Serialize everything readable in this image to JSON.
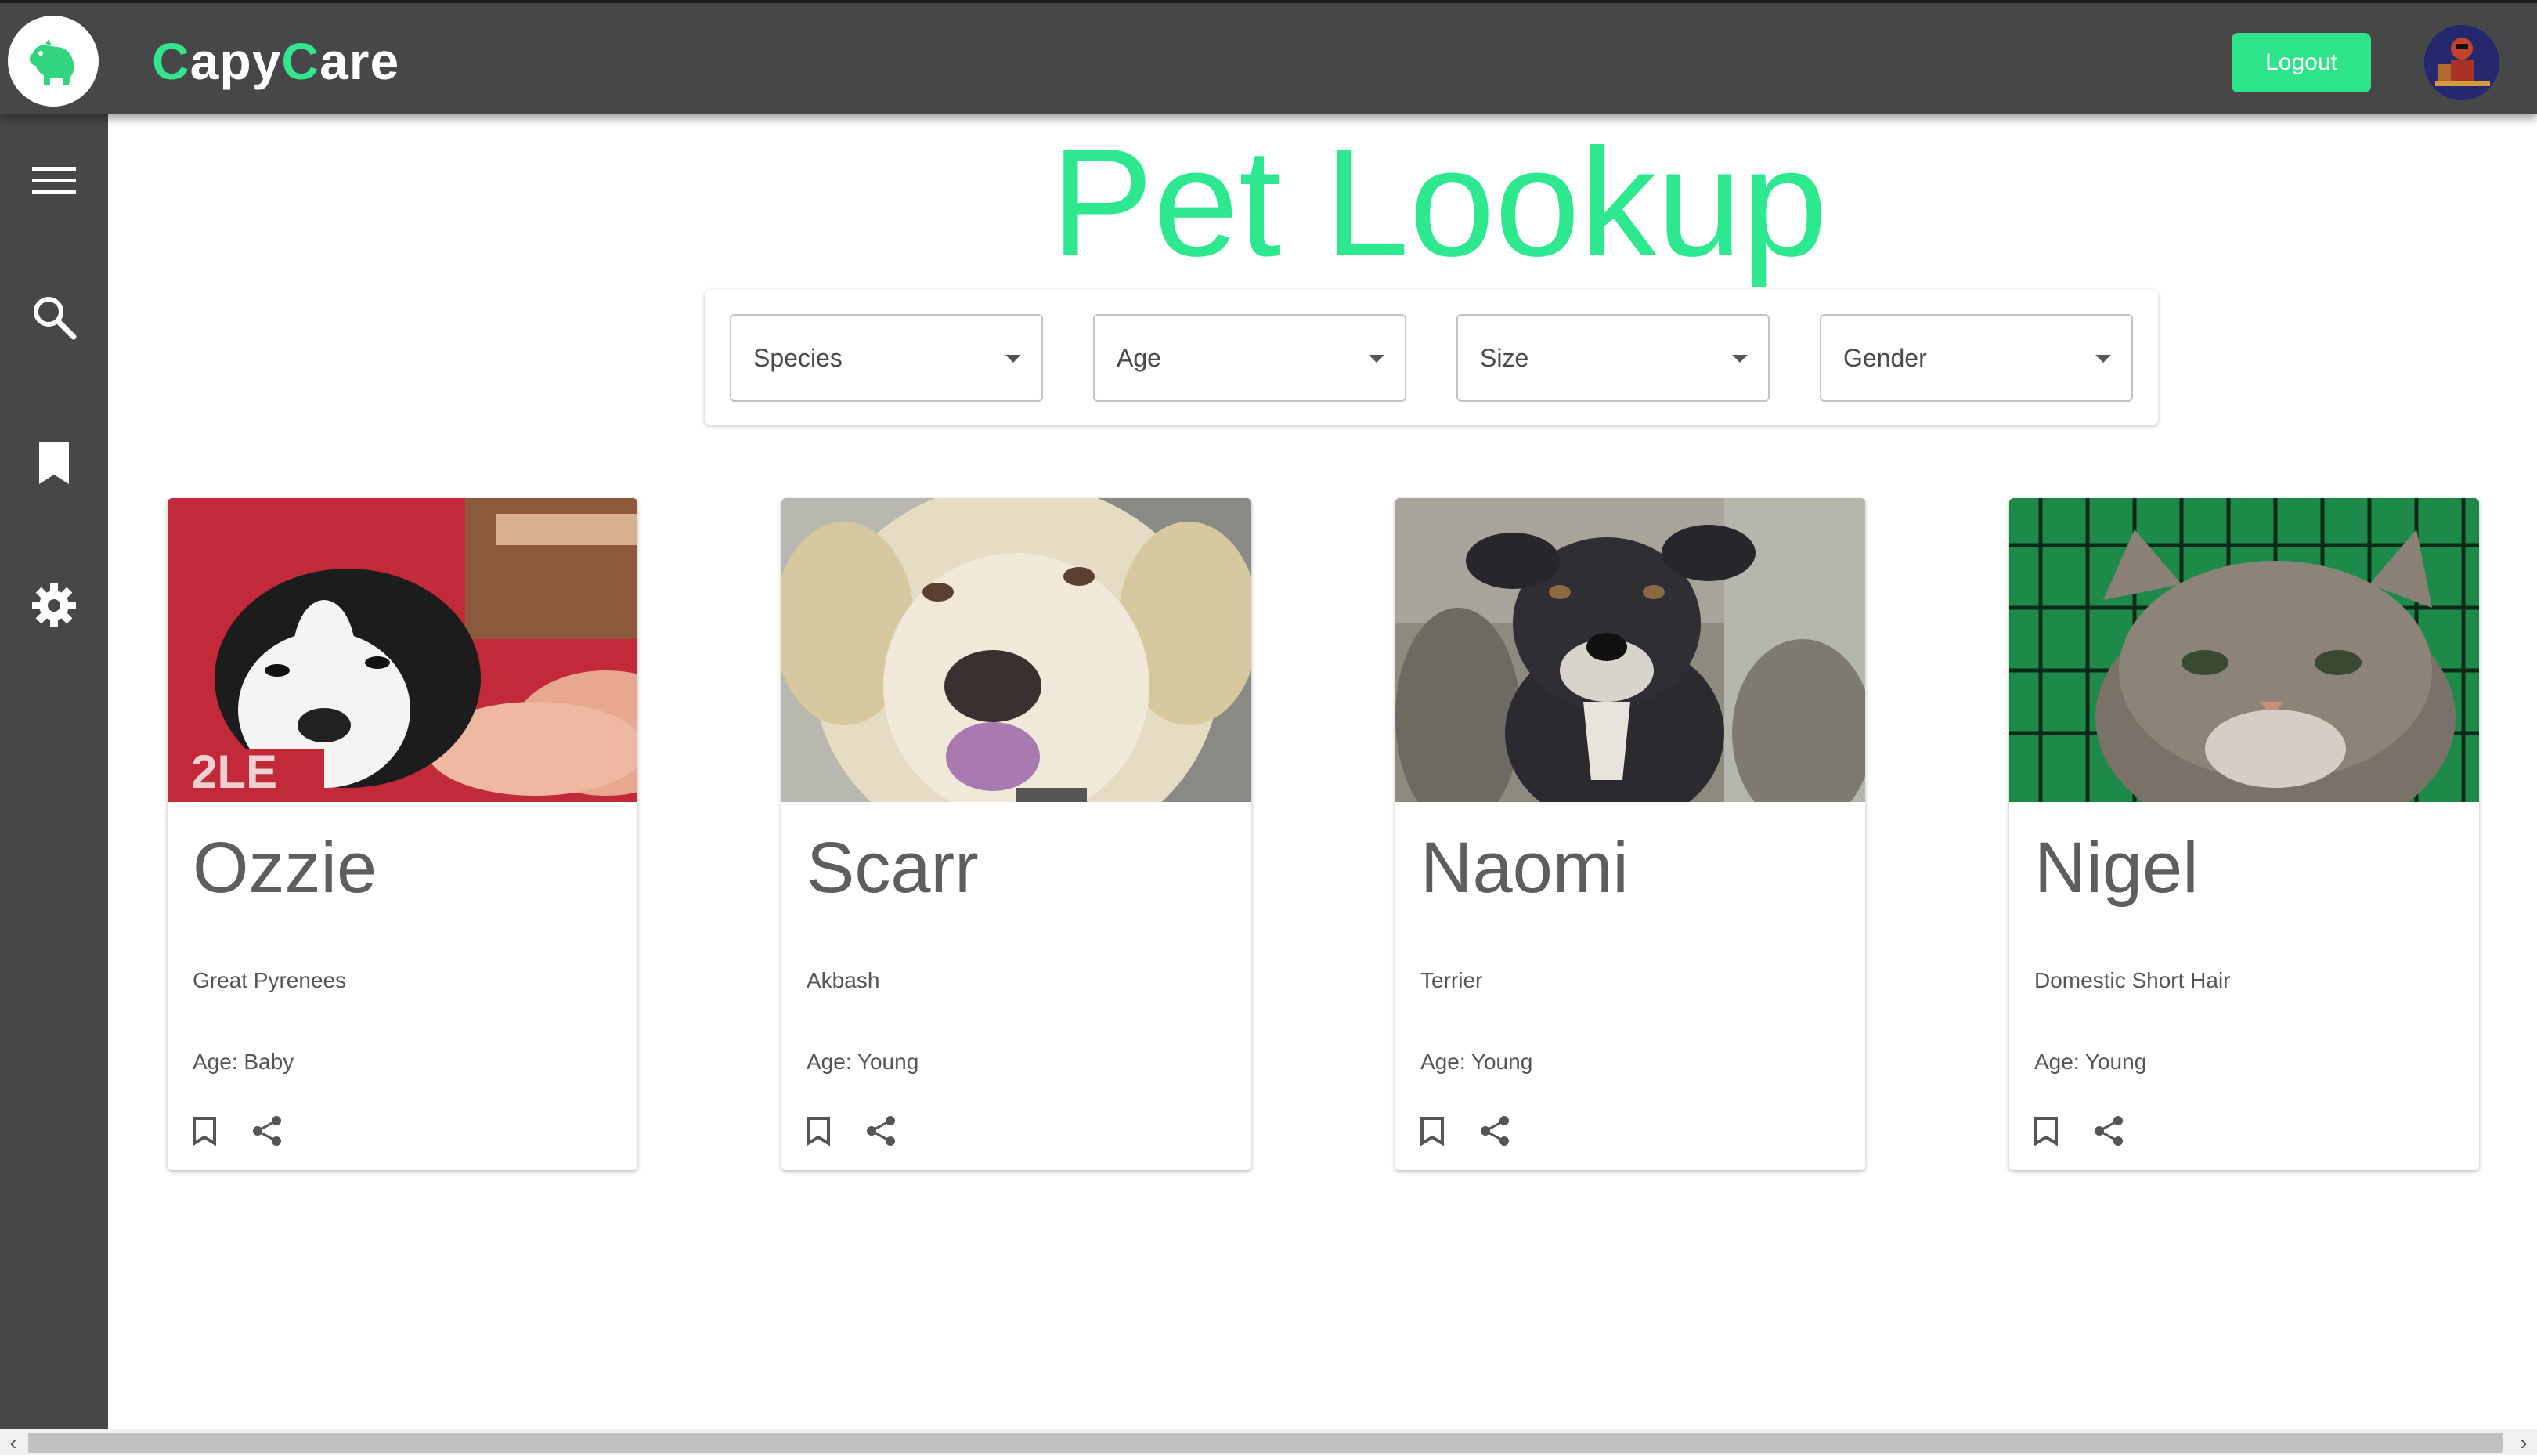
{
  "app": {
    "brand_parts": [
      "C",
      "apy",
      "C",
      "are"
    ],
    "accent_color": "#2ee890",
    "bar_color": "#474747"
  },
  "header": {
    "logout_label": "Logout",
    "logo_icon": "capybara-icon",
    "avatar_icon": "user-avatar"
  },
  "sidebar": {
    "items": [
      {
        "icon": "menu-icon"
      },
      {
        "icon": "search-icon"
      },
      {
        "icon": "bookmark-icon"
      },
      {
        "icon": "settings-gear-icon"
      }
    ]
  },
  "main": {
    "title": "Pet Lookup",
    "filters": [
      {
        "label": "Species"
      },
      {
        "label": "Age"
      },
      {
        "label": "Size"
      },
      {
        "label": "Gender"
      }
    ],
    "pets": [
      {
        "name": "Ozzie",
        "breed": "Great Pyrenees",
        "age": "Age: Baby"
      },
      {
        "name": "Scarr",
        "breed": "Akbash",
        "age": "Age: Young"
      },
      {
        "name": "Naomi",
        "breed": "Terrier",
        "age": "Age: Young"
      },
      {
        "name": "Nigel",
        "breed": "Domestic Short Hair",
        "age": "Age: Young"
      }
    ]
  }
}
